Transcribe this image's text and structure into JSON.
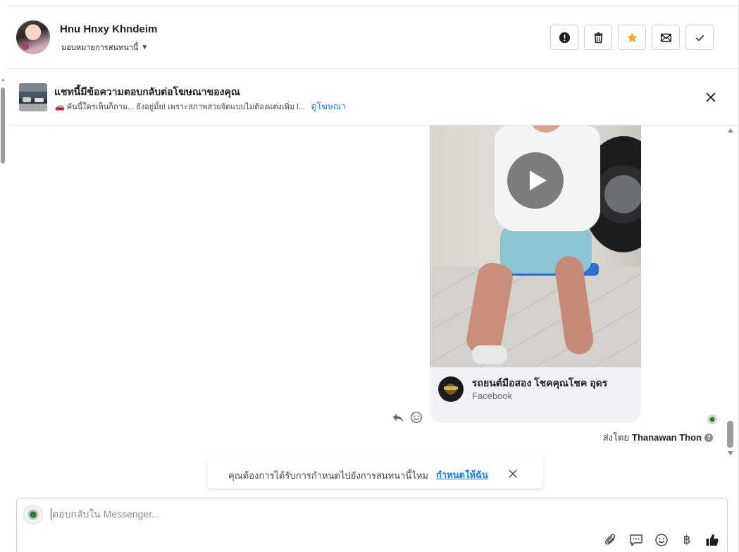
{
  "header": {
    "contact_name": "Hnu Hnxy Khndeim",
    "assign_label": "มอบหมายการสนทนานี้",
    "toolbar": [
      {
        "name": "mark-spam-button",
        "icon": "exclamation-circle-icon"
      },
      {
        "name": "delete-button",
        "icon": "trash-icon"
      },
      {
        "name": "star-button",
        "icon": "star-icon"
      },
      {
        "name": "mark-unread-button",
        "icon": "envelope-icon"
      },
      {
        "name": "mark-done-button",
        "icon": "checkmark-icon"
      }
    ],
    "accent_star": "#f5a623"
  },
  "ad_banner": {
    "title": "แชทนี้มีข้อความตอบกลับต่อโฆษณาของคุณ",
    "subtitle": "🚗 คันนี้ใครเห็นก็ถาม... ยังอยู่มั้ย! เพราะสภาพสวยจัดแบบไม่ต้องแต่งเพิ่ม l...",
    "view_ad_link": "ดูโฆษณา"
  },
  "message": {
    "shared_page_name": "รถยนต์มือสอง โชคคุณโชค อุดร",
    "shared_page_platform": "Facebook",
    "sent_by_prefix": "ส่งโดย",
    "sent_by_name": "Thanawan Thon"
  },
  "reminder": {
    "text": "คุณต้องการได้รับการกำหนดไปยังการสนทนานี้ไหม",
    "link": "กำหนดให้ฉัน"
  },
  "composer": {
    "placeholder": "ตอบกลับใน Messenger...",
    "tools": [
      "paperclip-icon",
      "saved-reply-icon",
      "emoji-icon",
      "baht-icon",
      "thumbs-up-icon"
    ],
    "baht_symbol": "฿"
  },
  "colors": {
    "link": "#1877f2",
    "border": "#dddfe2"
  }
}
